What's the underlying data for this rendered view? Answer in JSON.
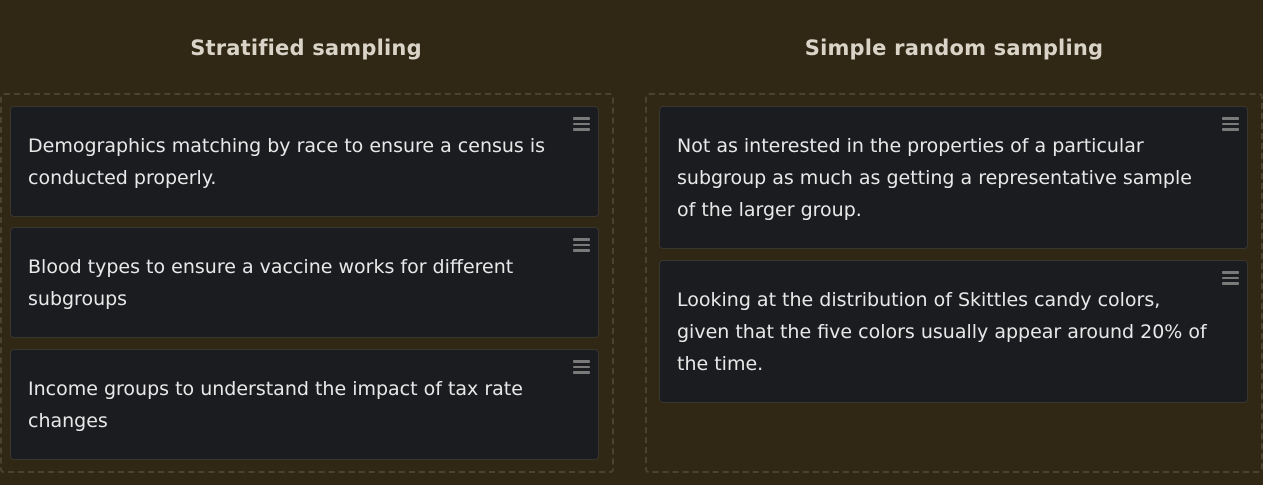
{
  "columns": [
    {
      "title": "Stratified sampling",
      "cards": [
        {
          "text": "Demographics matching by race to ensure a census is conducted properly."
        },
        {
          "text": "Blood types to ensure a vaccine works for different subgroups"
        },
        {
          "text": "Income groups to understand the impact of tax rate changes"
        }
      ]
    },
    {
      "title": "Simple random sampling",
      "cards": [
        {
          "text": "Not as interested in the properties of a particular subgroup as much as getting a representative sample of the larger group."
        },
        {
          "text": "Looking at the distribution of Skittles candy colors, given that the five colors usually appear around 20% of the time."
        }
      ]
    }
  ],
  "icons": {
    "drag_handle": "drag-handle-icon"
  },
  "colors": {
    "background": "#302714",
    "card": "#1b1c1f",
    "dropzone_border": "#4b4330",
    "text": "#e8e8e8",
    "title": "#d9d4c7"
  }
}
